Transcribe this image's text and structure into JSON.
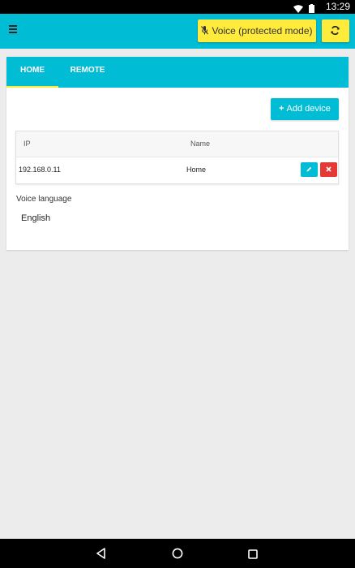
{
  "status_bar": {
    "time": "13:29"
  },
  "app_bar": {
    "voice_button_label": "Voice (protected mode)"
  },
  "tabs": [
    {
      "label": "HOME",
      "active": true
    },
    {
      "label": "REMOTE",
      "active": false
    }
  ],
  "main": {
    "add_device_label": "Add device",
    "table": {
      "columns": [
        "IP",
        "Name"
      ],
      "rows": [
        {
          "ip": "192.168.0.11",
          "name": "Home"
        }
      ]
    },
    "voice_language_label": "Voice language",
    "voice_language_value": "English"
  },
  "colors": {
    "accent": "#00bcd4",
    "highlight": "#ffeb3b",
    "danger": "#e53935"
  },
  "icons": [
    "menu-icon",
    "mic-off-icon",
    "refresh-icon",
    "plus-icon",
    "edit-icon",
    "delete-icon",
    "wifi-icon",
    "battery-icon",
    "back-icon",
    "home-icon",
    "recent-apps-icon"
  ]
}
